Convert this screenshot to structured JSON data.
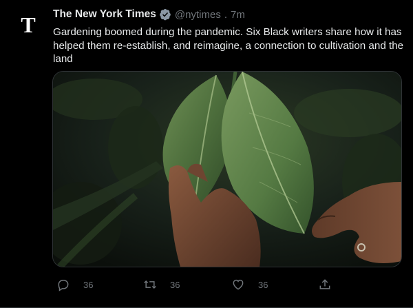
{
  "tweet": {
    "author_name": "The New York Times",
    "handle": "@nytimes",
    "separator": ".",
    "time": "7m",
    "text": "Gardening boomed during the pandemic. Six Black writers share how it has helped them re-establish, and reimagine, a connection to cultivation and the land",
    "avatar_logo_letter": "T",
    "verified_icon": "verified-badge-icon"
  },
  "actions": {
    "reply": {
      "icon": "reply-icon",
      "count": "36"
    },
    "retweet": {
      "icon": "retweet-icon",
      "count": "36"
    },
    "like": {
      "icon": "heart-icon",
      "count": "36"
    },
    "share": {
      "icon": "share-icon"
    }
  },
  "colors": {
    "background": "#000000",
    "text": "#e7e9ea",
    "secondary": "#71767b",
    "verified_badge": "#8b98a5"
  }
}
